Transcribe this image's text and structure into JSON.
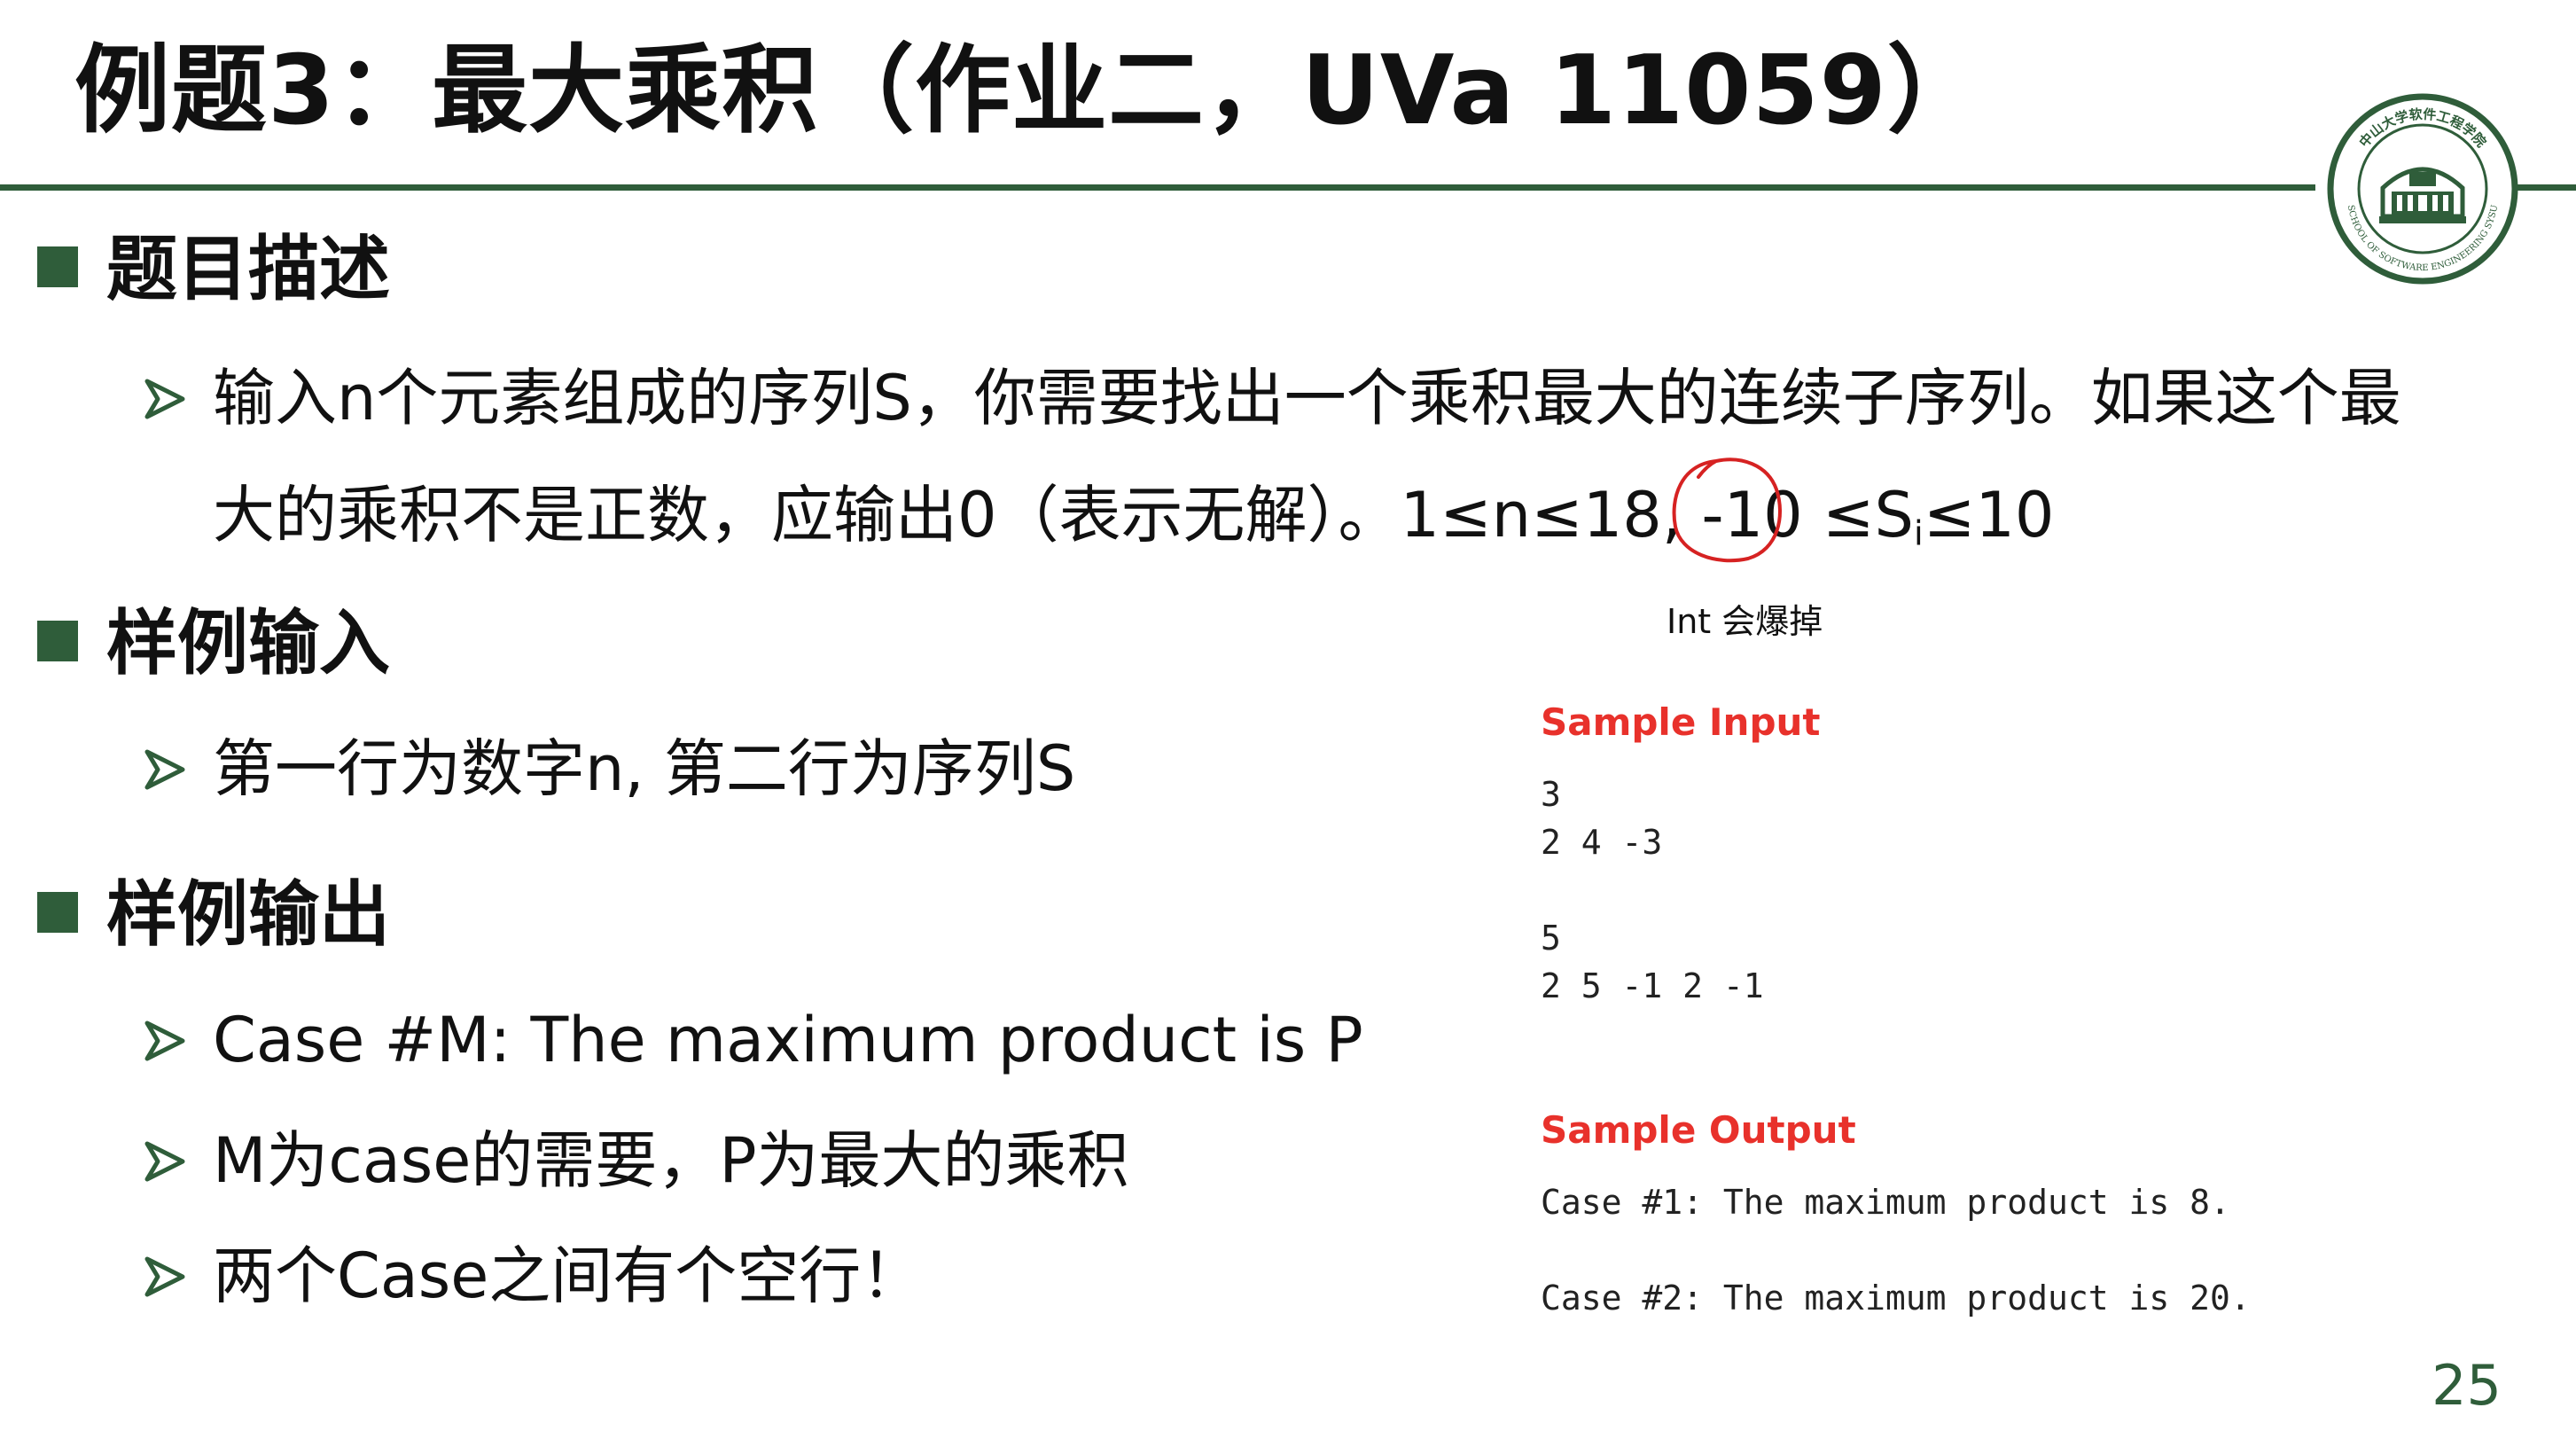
{
  "title": "例题3：最大乘积（作业二，UVa 11059）",
  "logo": {
    "text_top": "中山大学软件工程学院",
    "text_bottom": "SCHOOL OF SOFTWARE ENGINEERING SYSU"
  },
  "sections": [
    {
      "heading": "题目描述",
      "bullets": [
        "输入n个元素组成的序列S，你需要找出一个乘积最大的连续子序列。如果这个最",
        "大的乘积不是正数，应输出0（表示无解）。1≤n≤18, -10 ≤S"
      ],
      "sub": "i",
      "tail": "≤10"
    },
    {
      "heading": "样例输入",
      "bullets": [
        "第一行为数字n, 第二行为序列S"
      ]
    },
    {
      "heading": "样例输出",
      "bullets": [
        "Case #M: The maximum product is P",
        "M为case的需要，P为最大的乘积",
        "两个Case之间有个空行！"
      ]
    }
  ],
  "annotation": "Int 会爆掉",
  "sample_input": {
    "heading": "Sample Input",
    "lines": [
      "3",
      "2 4 -3",
      "",
      "5",
      "2 5 -1 2 -1"
    ]
  },
  "sample_output": {
    "heading": "Sample Output",
    "lines": [
      "Case #1: The maximum product is 8.",
      "",
      "Case #2: The maximum product is 20."
    ]
  },
  "page_number": "25",
  "colors": {
    "accent_green": "#2f5d3a",
    "sample_red": "#e8312b",
    "circle_red": "#d62222"
  }
}
